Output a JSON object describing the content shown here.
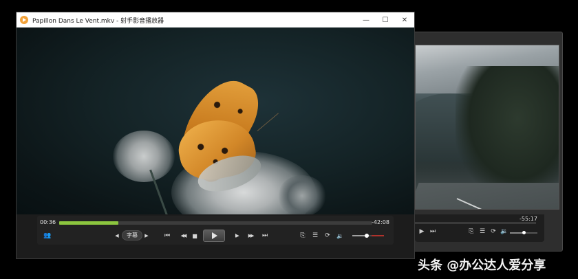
{
  "back_window": {
    "time_remaining": "-55:17",
    "icons": [
      "play-icon",
      "skip-forward-icon",
      "clip-icon",
      "playlist-icon",
      "rotate-icon",
      "volume-icon"
    ],
    "volume_level": 0.5
  },
  "front_window": {
    "title": "Papillon Dans Le Vent.mkv - 射手影音播放器",
    "window_buttons": {
      "minimize": "—",
      "maximize": "☐",
      "close": "✕"
    },
    "controls": {
      "time_elapsed": "00:36",
      "time_remaining": "-42:08",
      "progress": 0.19,
      "subtitle_label": "字幕",
      "volume_level": 0.45,
      "icons": {
        "profile": "👥",
        "sub_prev": "◀",
        "sub_next": "▶",
        "prev_track": "⏮",
        "rewind": "◀◀",
        "stop": "■",
        "step_frame": "I▶",
        "forward": "▶▶",
        "next_track": "⏭",
        "clip": "⎘",
        "playlist": "☰",
        "rotate": "⟳",
        "volume": "🔉"
      }
    }
  },
  "watermark": "头条 @办公达人爱分享",
  "colors": {
    "progress_green": "#8cc63f",
    "volume_red": "#b0322c",
    "app_icon": "#f2a23a"
  }
}
